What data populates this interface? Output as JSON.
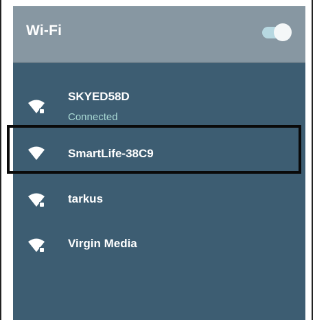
{
  "header": {
    "title": "Wi-Fi",
    "toggle_state": "on"
  },
  "networks": [
    {
      "name": "SKYED58D",
      "status": "Connected",
      "secured": true,
      "icon": "wifi-locked-icon"
    },
    {
      "name": "SmartLife-38C9",
      "status": "",
      "secured": false,
      "icon": "wifi-icon",
      "highlighted": true
    },
    {
      "name": "tarkus",
      "status": "",
      "secured": true,
      "icon": "wifi-locked-icon"
    },
    {
      "name": "Virgin Media",
      "status": "",
      "secured": true,
      "icon": "wifi-locked-icon"
    }
  ],
  "colors": {
    "header_bg": "#8797a2",
    "panel_bg": "#3d5d72",
    "connected_text": "#a9d9d4",
    "toggle_track": "#b7d8e1",
    "highlight_border": "#0a0a0a"
  }
}
